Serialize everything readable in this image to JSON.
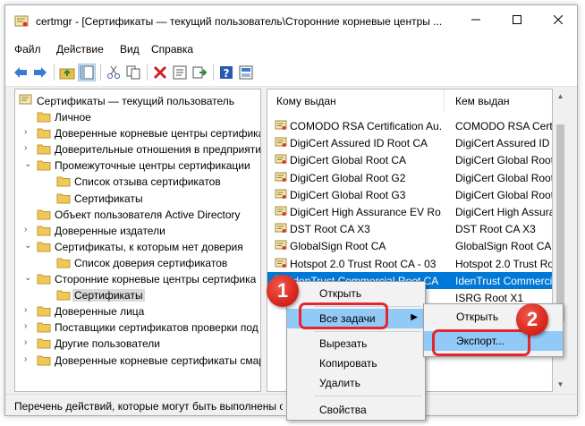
{
  "window": {
    "title": "certmgr - [Сертификаты — текущий пользователь\\Сторонние корневые центры ..."
  },
  "menu": [
    "Файл",
    "Действие",
    "Вид",
    "Справка"
  ],
  "icons": {
    "app": "certmgr-icon",
    "back": "back-arrow-icon",
    "forward": "forward-arrow-icon",
    "up": "up-folder-icon",
    "show_tree": "show-tree-icon",
    "cut": "cut-icon",
    "copy": "copy-icon",
    "delete": "delete-icon",
    "properties": "properties-icon",
    "export": "export-list-icon",
    "help": "help-icon",
    "mmc": "mmc-icon"
  },
  "tree": {
    "root": "Сертификаты — текущий пользователь",
    "items": [
      "Личное",
      "Доверенные корневые центры сертифика",
      "Доверительные отношения в предприяти",
      "Промежуточные центры сертификации",
      "Список отзыва сертификатов",
      "Сертификаты",
      "Объект пользователя Active Directory",
      "Доверенные издатели",
      "Сертификаты, к которым нет доверия",
      "Список доверия сертификатов",
      "Сторонние корневые центры сертифика",
      "Сертификаты",
      "Доверенные лица",
      "Поставщики сертификатов проверки под",
      "Другие пользователи",
      "Доверенные корневые сертификаты смар"
    ]
  },
  "list": {
    "col_issued_to": "Кому выдан",
    "col_issued_by": "Кем выдан",
    "rows": [
      [
        "COMODO RSA Certification Au...",
        "COMODO RSA Certific"
      ],
      [
        "DigiCert Assured ID Root CA",
        "DigiCert Assured ID"
      ],
      [
        "DigiCert Global Root CA",
        "DigiCert Global Root"
      ],
      [
        "DigiCert Global Root G2",
        "DigiCert Global Root"
      ],
      [
        "DigiCert Global Root G3",
        "DigiCert Global Root"
      ],
      [
        "DigiCert High Assurance EV Ro...",
        "DigiCert High Assura"
      ],
      [
        "DST Root CA X3",
        "DST Root CA X3"
      ],
      [
        "GlobalSign Root CA",
        "GlobalSign Root CA"
      ],
      [
        "Hotspot 2.0 Trust Root CA - 03",
        "Hotspot 2.0 Trust Ro"
      ],
      [
        "IdenTrust Commercial Root CA 1",
        "IdenTrust Commercial"
      ],
      [
        "",
        "ISRG Root X1"
      ],
      [
        "",
        "VeriSign Universal Roo"
      ]
    ]
  },
  "context_menu": {
    "open": "Открыть",
    "all_tasks": "Все задачи",
    "cut": "Вырезать",
    "copy": "Копировать",
    "delete": "Удалить",
    "properties": "Свойства"
  },
  "submenu": {
    "open": "Открыть",
    "export": "Экспорт..."
  },
  "status": "Перечень действий, которые могут быть выполнены с д",
  "badges": [
    "1",
    "2"
  ],
  "colors": {
    "selection": "#0078d7",
    "menu_hover": "#91c9f7",
    "callout": "#e6252e"
  }
}
